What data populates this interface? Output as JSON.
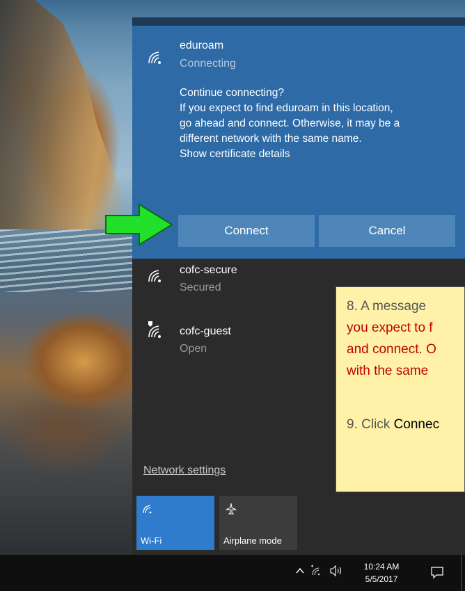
{
  "flyout": {
    "expanded_network": {
      "name": "eduroam",
      "status": "Connecting",
      "prompt_lines": [
        "Continue connecting?",
        "If you expect to find eduroam in this location,",
        "go ahead and connect. Otherwise, it may be a",
        "different network with the same name.",
        "Show certificate details"
      ],
      "connect_label": "Connect",
      "cancel_label": "Cancel"
    },
    "networks": [
      {
        "name": "cofc-secure",
        "status": "Secured",
        "icon": "wifi-icon"
      },
      {
        "name": "cofc-guest",
        "status": "Open",
        "icon": "wifi-shield-icon"
      }
    ],
    "network_settings_label": "Network settings",
    "quick_actions": [
      {
        "label": "Wi-Fi",
        "icon": "wifi-icon",
        "active": true
      },
      {
        "label": "Airplane mode",
        "icon": "airplane-icon",
        "active": false
      }
    ],
    "colors": {
      "accent": "#2d6aa6",
      "button": "#4e86ba",
      "panel": "#2b2b2b",
      "tile_active": "#2f7bcc"
    }
  },
  "taskbar": {
    "time": "10:24 AM",
    "date": "5/5/2017"
  },
  "callout": {
    "step8_prefix": "8.  A message",
    "step8_lines": [
      "you expect to f",
      "and connect. O",
      "with the same"
    ],
    "step9_prefix": "9. Click ",
    "step9_bold": "Connec"
  }
}
